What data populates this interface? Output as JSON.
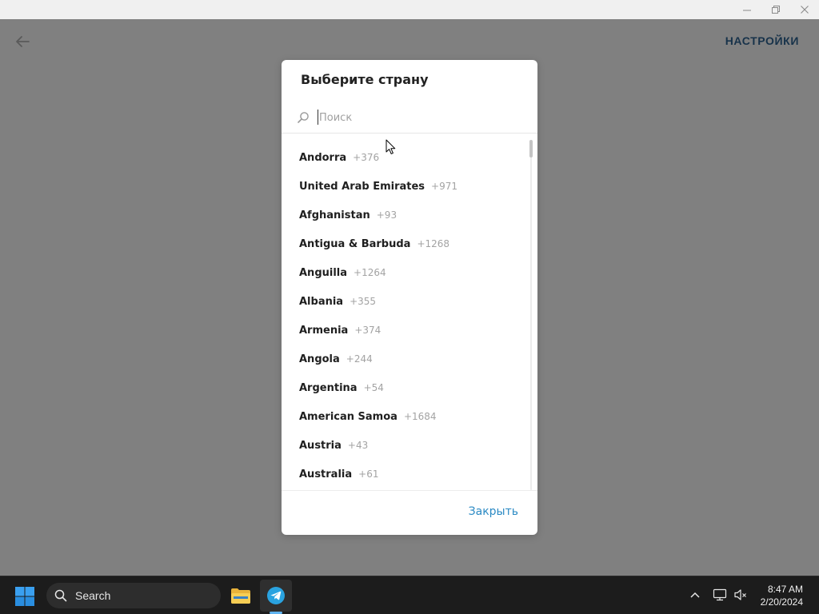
{
  "app": {
    "settings_label": "НАСТРОЙКИ"
  },
  "dialog": {
    "title": "Выберите страну",
    "search_placeholder": "Поиск",
    "search_value": "",
    "close_label": "Закрыть",
    "countries": [
      {
        "name": "Andorra",
        "code": "+376"
      },
      {
        "name": "United Arab Emirates",
        "code": "+971"
      },
      {
        "name": "Afghanistan",
        "code": "+93"
      },
      {
        "name": "Antigua & Barbuda",
        "code": "+1268"
      },
      {
        "name": "Anguilla",
        "code": "+1264"
      },
      {
        "name": "Albania",
        "code": "+355"
      },
      {
        "name": "Armenia",
        "code": "+374"
      },
      {
        "name": "Angola",
        "code": "+244"
      },
      {
        "name": "Argentina",
        "code": "+54"
      },
      {
        "name": "American Samoa",
        "code": "+1684"
      },
      {
        "name": "Austria",
        "code": "+43"
      },
      {
        "name": "Australia",
        "code": "+61"
      }
    ]
  },
  "taskbar": {
    "search_label": "Search",
    "time": "8:47 AM",
    "date": "2/20/2024",
    "apps": [
      "file-explorer",
      "telegram"
    ]
  },
  "colors": {
    "accent": "#2b8ac4",
    "overlay": "#808080",
    "settings_text": "#17324a",
    "taskbar": "#1c1c1c"
  },
  "icons": {
    "back": "arrow-left-icon",
    "search": "search-icon",
    "minimize": "minimize-icon",
    "restore": "restore-icon",
    "close": "close-icon",
    "start": "windows-start-icon",
    "explorer": "folder-icon",
    "telegram": "telegram-icon",
    "tray_chevron": "chevron-up-icon",
    "network": "network-icon",
    "volume": "volume-muted-icon"
  }
}
